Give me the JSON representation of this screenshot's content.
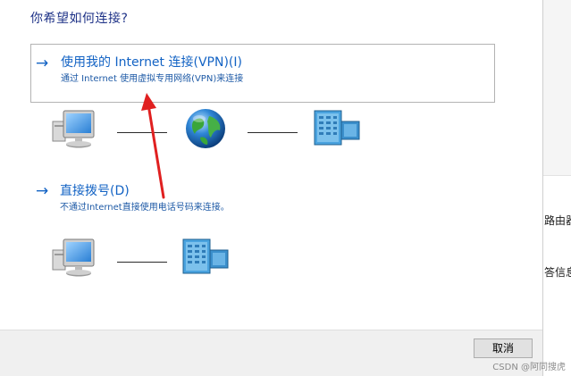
{
  "dialog": {
    "heading": "你希望如何连接?",
    "options": [
      {
        "arrow": "→",
        "title": "使用我的 Internet 连接(VPN)(I)",
        "description": "通过 Internet 使用虚拟专用网络(VPN)来连接",
        "selected": true
      },
      {
        "arrow": "→",
        "title": "直接拨号(D)",
        "description": "不通过Internet直接使用电话号码来连接。",
        "selected": false
      }
    ],
    "cancel_label": "取消"
  },
  "background_window": {
    "texts": [
      "路由器",
      "答信息"
    ]
  },
  "watermark": "CSDN @阿同搜虎",
  "colors": {
    "link_blue": "#1363c4",
    "heading_blue": "#1e3287",
    "annotation_red": "#e02020"
  }
}
